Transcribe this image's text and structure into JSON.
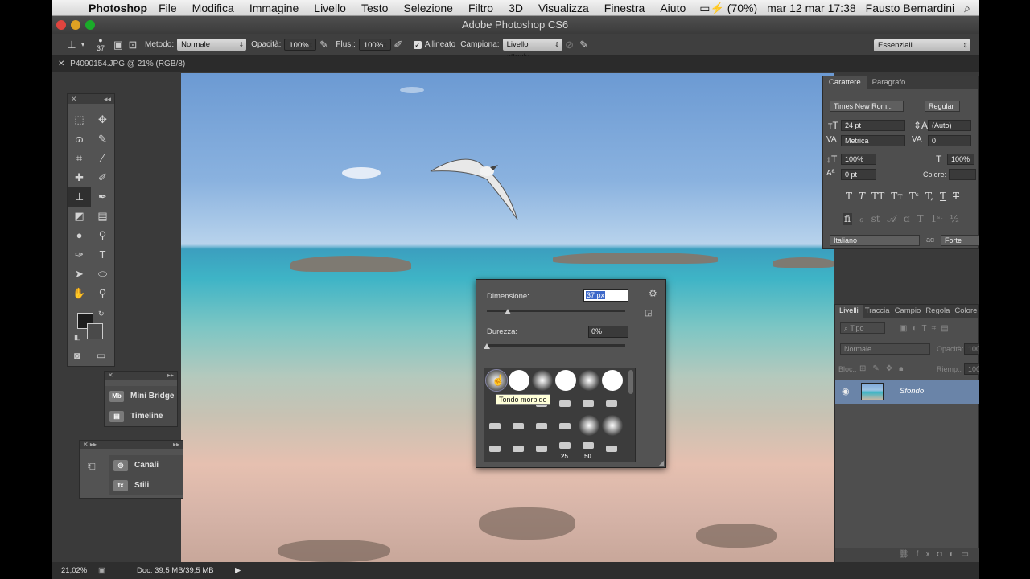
{
  "menubar": {
    "app": "Photoshop",
    "items": [
      "File",
      "Modifica",
      "Immagine",
      "Livello",
      "Testo",
      "Selezione",
      "Filtro",
      "3D",
      "Visualizza",
      "Finestra",
      "Aiuto"
    ],
    "battery": "(70%)",
    "datetime": "mar 12 mar  17:38",
    "user": "Fausto Bernardini"
  },
  "window": {
    "title": "Adobe Photoshop CS6"
  },
  "options": {
    "brush_size": "37",
    "mode_label": "Metodo:",
    "mode_value": "Normale",
    "opacity_label": "Opacità:",
    "opacity_value": "100%",
    "flow_label": "Flus.:",
    "flow_value": "100%",
    "aligned_label": "Allineato",
    "sample_label": "Campiona:",
    "sample_value": "Livello attuale",
    "workspace": "Essenziali"
  },
  "document": {
    "tab_title": "P4090154.JPG @ 21% (RGB/8)"
  },
  "mini_panels": {
    "mini_bridge": "Mini Bridge",
    "timeline": "Timeline",
    "channels": "Canali",
    "styles": "Stili"
  },
  "character": {
    "tab_character": "Carattere",
    "tab_paragraph": "Paragrafo",
    "font_family": "Times New Rom...",
    "font_style": "Regular",
    "font_size": "24 pt",
    "leading": "(Auto)",
    "kerning": "Metrica",
    "tracking": "0",
    "vertical_scale": "100%",
    "horizontal_scale": "100%",
    "baseline_shift": "0 pt",
    "color_label": "Colore:",
    "language": "Italiano",
    "antialias_icon": "aɑ",
    "antialias": "Forte"
  },
  "layers": {
    "tabs": [
      "Livelli",
      "Traccia",
      "Campio",
      "Regola",
      "Colore"
    ],
    "filter": "Tipo",
    "blend_mode": "Normale",
    "opacity_label": "Opacità:",
    "opacity_value": "100",
    "lock_label": "Bloc.:",
    "fill_label": "Riemp.:",
    "fill_value": "100",
    "layer_name": "Sfondo"
  },
  "brush_picker": {
    "size_label": "Dimensione:",
    "size_value": "37 px",
    "size_fraction": 0.15,
    "hardness_label": "Durezza:",
    "hardness_value": "0%",
    "hardness_fraction": 0.0,
    "tooltip": "Tondo morbido",
    "label_25": "25",
    "label_50": "50"
  },
  "status": {
    "zoom": "21,02%",
    "doc": "Doc: 39,5 MB/39,5 MB"
  }
}
